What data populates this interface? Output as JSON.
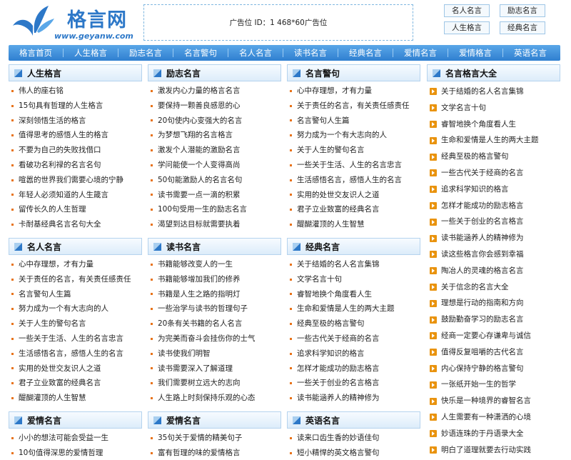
{
  "logo": {
    "name": "格言网",
    "url": "www.geyanw.com"
  },
  "ad": {
    "text": "广告位 ID：1 468*60广告位"
  },
  "toplinks": [
    "名人名言",
    "励志名言",
    "人生格言",
    "经典名言"
  ],
  "nav": [
    "格言首页",
    "人生格言",
    "励志名言",
    "名言警句",
    "名人名言",
    "读书名言",
    "经典名言",
    "爱情名言",
    "爱情格言",
    "英语名言"
  ],
  "col1": {
    "sections": [
      {
        "title": "人生格言",
        "items": [
          "伟人的座右铭",
          "15句具有哲理的人生格言",
          "深刻领悟生活的格言",
          "值得思考的感悟人生的格言",
          "不要为自己的失败找借口",
          "看破功名利禄的名言名句",
          "喧嚣的世界我们需要心境的宁静",
          "年轻人必须知道的人生箴言",
          "留传长久的人生哲理",
          "卡耐基经典名言名句大全"
        ]
      },
      {
        "title": "名人名言",
        "items": [
          "心中存理想，才有力量",
          "关于责任的名言，有关责任感责任",
          "名言警句人生篇",
          "努力成为一个有大志向的人",
          "关于人生的警句名言",
          "一些关于生活、人生的名言忠言",
          "生活感悟名言，感悟人生的名言",
          "实用的处世交友识人之道",
          "君子立业致富的经典名言",
          "醍醐灌顶的人生智慧"
        ]
      },
      {
        "title": "爱情名言",
        "items": [
          "小小的想法可能会受益一生",
          "10句值得深思的爱情哲理"
        ]
      }
    ]
  },
  "col2": {
    "sections": [
      {
        "title": "励志名言",
        "items": [
          "激发内心力量的格言名言",
          "要保持一颗善良感恩的心",
          "20句使内心变强大的名言",
          "为梦想飞翔的名言格言",
          "激发个人潜能的激励名言",
          "学问能使一个人变得高尚",
          "50句能激励人的名言名句",
          "读书需要一点一滴的积累",
          "100句受用一生的励志名言",
          "渴望到达目标就需要执着"
        ]
      },
      {
        "title": "读书名言",
        "items": [
          "书籍能够改变人的一生",
          "书籍能够增加我们的修养",
          "书籍是人生之路的指明灯",
          "一些治学与读书的哲理句子",
          "20条有关书籍的名人名言",
          "为完美而奋斗会挂伤你的士气",
          "读书使我们明智",
          "读书需要深入了解道理",
          "我们需要树立远大的志向",
          "人生路上时刻保持乐观的心态"
        ]
      },
      {
        "title": "爱情名言",
        "items": [
          "35句关于爱情的精美句子",
          "富有哲理的味的爱情格言"
        ]
      }
    ]
  },
  "col3": {
    "sections": [
      {
        "title": "名言警句",
        "items": [
          "心中存理想，才有力量",
          "关于责任的名言，有关责任感责任",
          "名言警句人生篇",
          "努力成为一个有大志向的人",
          "关于人生的警句名言",
          "一些关于生活、人生的名言忠言",
          "生活感悟名言，感悟人生的名言",
          "实用的处世交友识人之道",
          "君子立业致富的经典名言",
          "醍醐灌顶的人生智慧"
        ]
      },
      {
        "title": "经典名言",
        "items": [
          "关于结婚的名人名言集锦",
          "文学名言十句",
          "睿智地换个角度看人生",
          "生命和爱情是人生的两大主题",
          "经典至极的格言警句",
          "一些古代关于经商的名言",
          "追求科学知识的格言",
          "怎样才能成功的励志格言",
          "一些关于创业的名言格言",
          "读书能涵养人的精神修为"
        ]
      },
      {
        "title": "英语名言",
        "items": [
          "读来口齿生香的妙语佳句",
          "短小精悍的英文格言警句"
        ]
      }
    ]
  },
  "right": {
    "title": "名言格言大全",
    "items": [
      "关于结婚的名人名言集锦",
      "文学名言十句",
      "睿智地换个角度看人生",
      "生命和爱情是人生的两大主题",
      "经典至极的格言警句",
      "一些古代关于经商的名言",
      "追求科学知识的格言",
      "怎样才能成功的励志格言",
      "一些关于创业的名言格言",
      "读书能涵养人的精神修为",
      "读这些格言你会感到幸福",
      "陶冶人的灵魂的格言名言",
      "关于信念的名言大全",
      "理想是行动的指南和方向",
      "鼓励勤奋学习的励志名言",
      "经商一定要心存谦卑与诚信",
      "值得反复咀嚼的古代名言",
      "内心保持宁静的格言警句",
      "一张纸开始一生的哲学",
      "快乐是一种境界的睿智名言",
      "人生需要有一种潇洒的心境",
      "妙语连珠的于丹语录大全",
      "明白了道理就要去行动实践",
      "好作文离不开名人名言"
    ]
  },
  "colors": {
    "nav": "#2f7fd0",
    "accent": "#e8731a",
    "brand": "#2d78c8"
  }
}
